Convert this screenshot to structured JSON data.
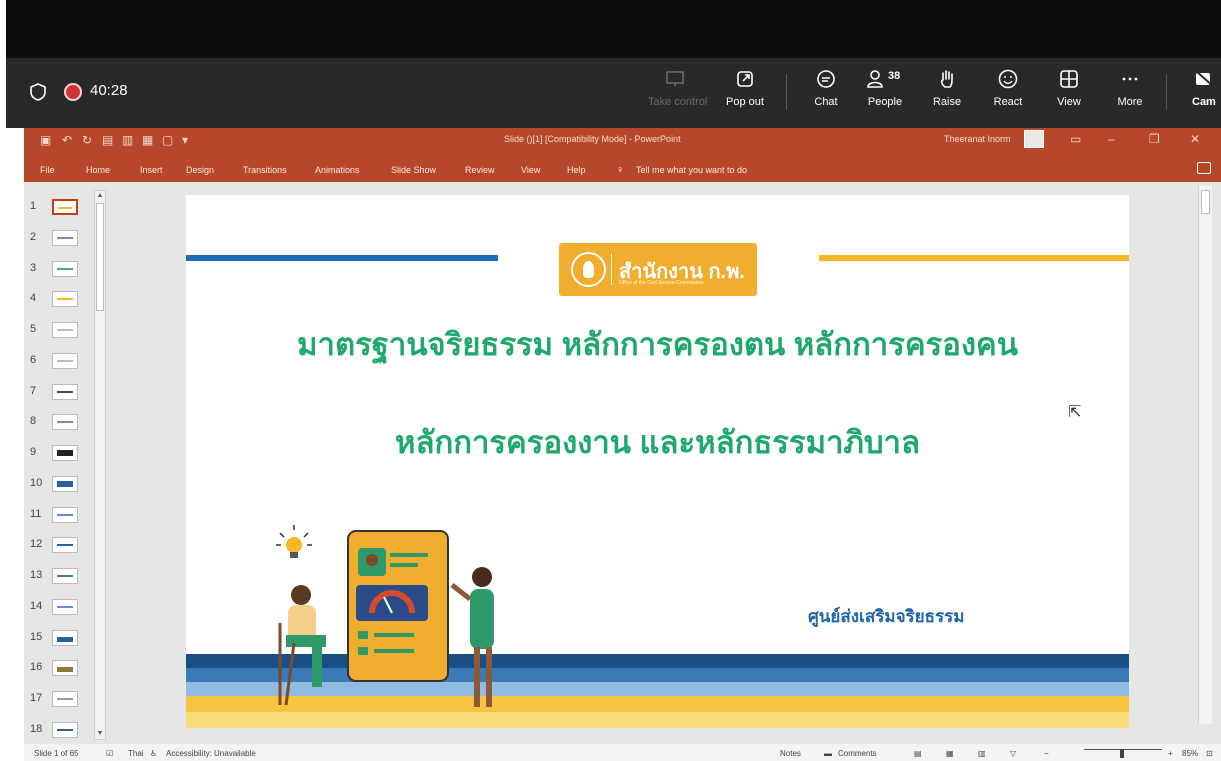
{
  "teams": {
    "timer": "40:28",
    "buttons": {
      "take_control": "Take control",
      "pop_out": "Pop out",
      "chat": "Chat",
      "people": "People",
      "people_count": "38",
      "raise": "Raise",
      "react": "React",
      "view": "View",
      "more": "More",
      "camera": "Cam"
    }
  },
  "powerpoint": {
    "document_title": "Slide ()[1] [Compatibility Mode] - PowerPoint",
    "user": "Theeranat Inorm",
    "tabs": [
      "File",
      "Home",
      "Insert",
      "Design",
      "Transitions",
      "Animations",
      "Slide Show",
      "Review",
      "View",
      "Help"
    ],
    "tell_me": "Tell me what you want to do",
    "thumbnails": [
      "1",
      "2",
      "3",
      "4",
      "5",
      "6",
      "7",
      "8",
      "9",
      "10",
      "11",
      "12",
      "13",
      "14",
      "15",
      "16",
      "17",
      "18"
    ],
    "selected_slide": "1",
    "status": {
      "slide_counter": "Slide 1 of 65",
      "language": "Thai",
      "accessibility": "Accessibility: Unavailable",
      "notes": "Notes",
      "comments": "Comments",
      "zoom": "85%"
    }
  },
  "slide": {
    "logo_name": "สำนักงาน ก.พ.",
    "logo_sub": "Office of the Civil Service Commission",
    "title_line1": "มาตรฐานจริยธรรม หลักการครองตน หลักการครองคน",
    "title_line2": "หลักการครองงาน และหลักธรรมาภิบาล",
    "center_name": "ศูนย์ส่งเสริมจริยธรรม"
  },
  "colors": {
    "teams_bar": "#292929",
    "ppt_accent": "#b7472a",
    "title_green": "#1ea86b",
    "logo_orange": "#f1ad2d",
    "band_navy": "#1a4f86",
    "band_yellow": "#f7c341"
  }
}
